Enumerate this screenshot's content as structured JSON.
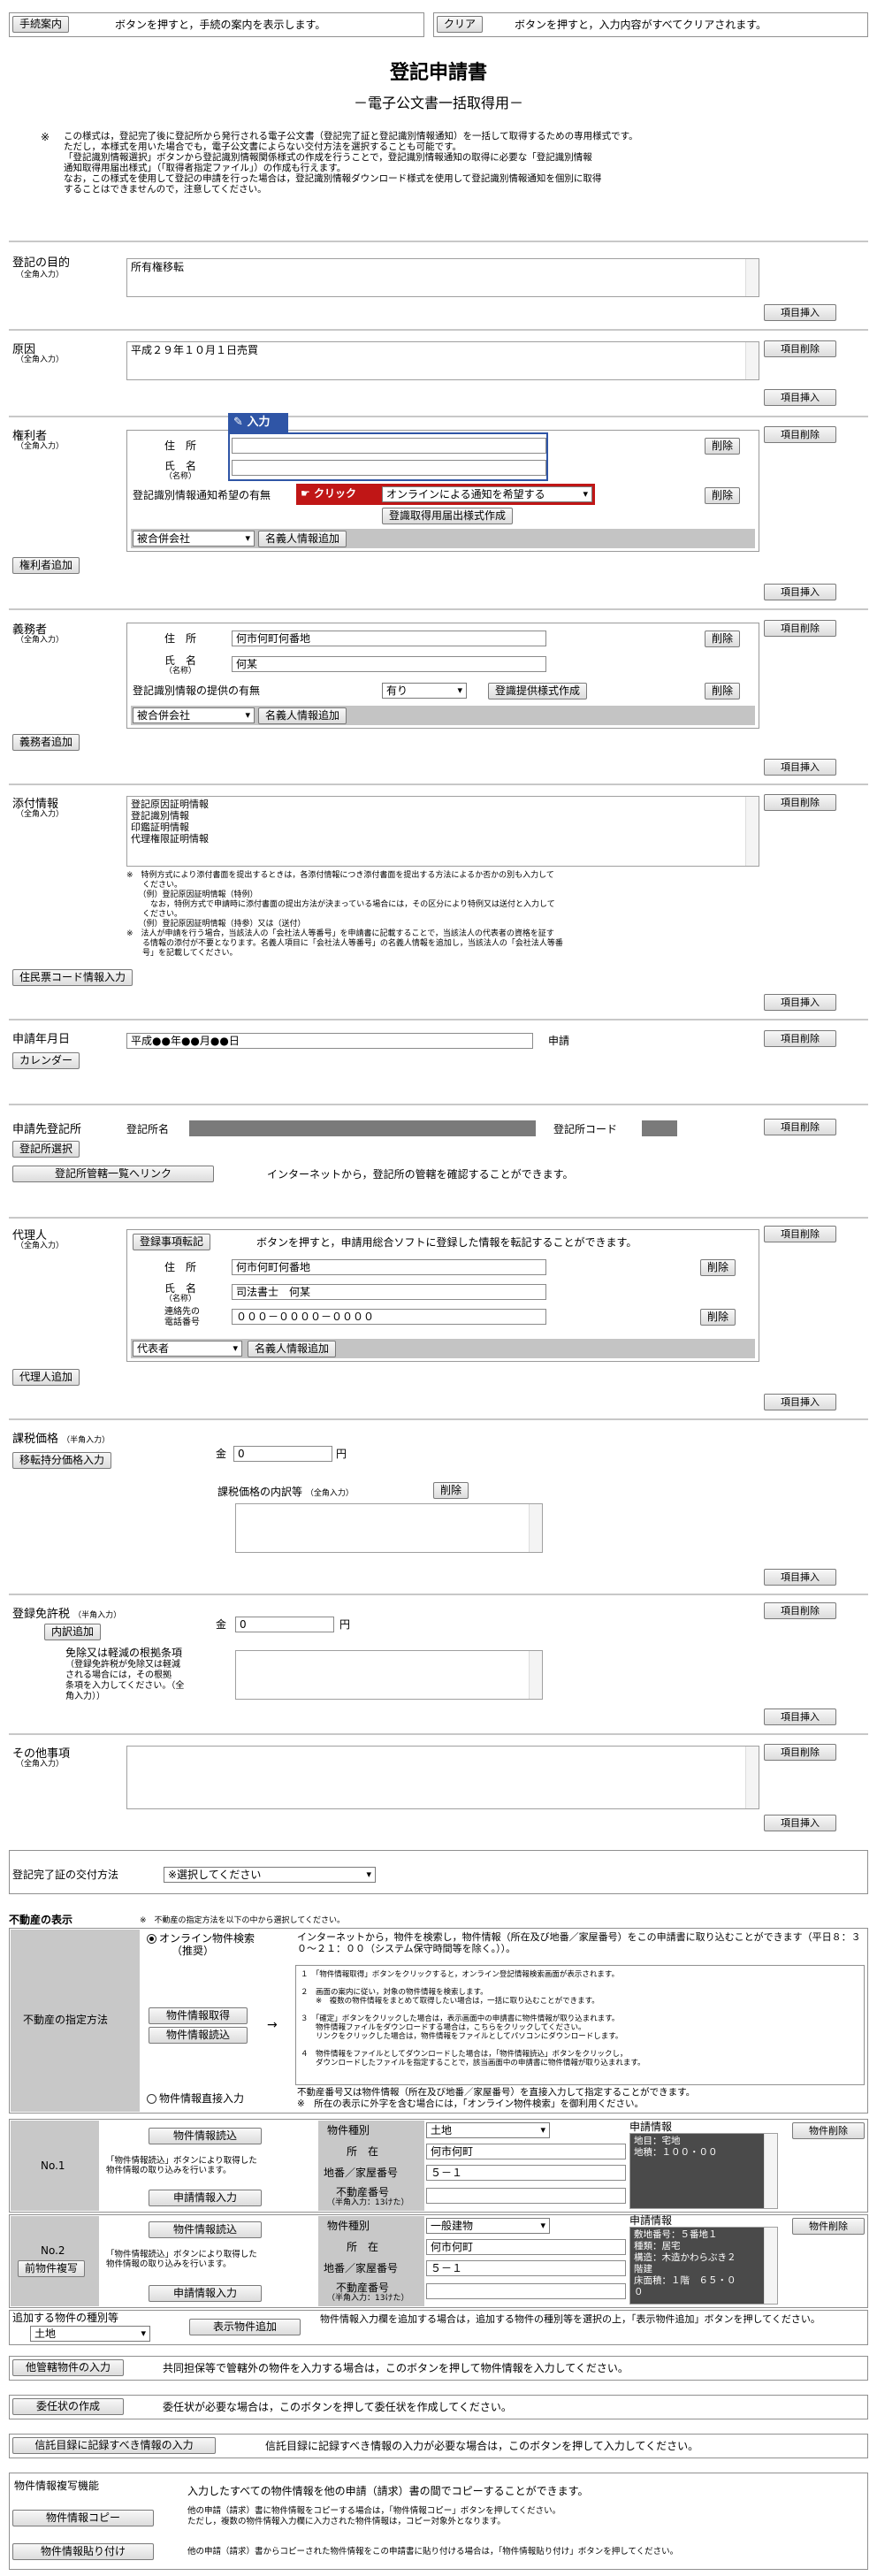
{
  "top": {
    "guide_button": "手続案内",
    "guide_text": "ボタンを押すと，手続の案内を表示します。",
    "clear_button": "クリア",
    "clear_text": "ボタンを押すと，入力内容がすべてクリアされます。"
  },
  "title": "登記申請書",
  "subtitle": "－電子公文書一括取得用－",
  "notice": {
    "mark": "※",
    "line1": "この様式は，登記完了後に登記所から発行される電子公文書（登記完了証と登記識別情報通知）を一括して取得するための専用様式です。",
    "line2": "ただし，本様式を用いた場合でも，電子公文書によらない交付方法を選択することも可能です。",
    "line3": "「登記識別情報選択」ボタンから登記識別情報関係様式の作成を行うことで，登記識別情報通知の取得に必要な「登記識別情報",
    "line4": "通知取得用届出様式」（「取得者指定ファイル」）の作成も行えます。",
    "line5": "なお，この様式を使用して登記の申請を行った場合は，登記識別情報ダウンロード様式を使用して登記識別情報通知を個別に取得",
    "line6": "することはできませんので，注意してください。"
  },
  "side": {
    "delete_item": "項目削除",
    "insert_item": "項目挿入"
  },
  "common": {
    "zen": "（全角入力）",
    "delete": "削除",
    "name_add": "名義人情報追加",
    "name_label": "氏　名",
    "name_sub": "（名称）",
    "address_label": "住　所"
  },
  "purpose": {
    "label": "登記の目的",
    "value": "所有権移転"
  },
  "cause": {
    "label": "原因",
    "value": "平成２９年１０月１日売買"
  },
  "rights": {
    "label": "権利者",
    "callout_input": "入力",
    "callout_click": "クリック",
    "notice_label": "登記識別情報通知希望の有無",
    "notice_value": "オンラインによる通知を希望する",
    "form_button": "登識取得用届出様式作成",
    "company_select": "被合併会社",
    "add_button": "権利者追加"
  },
  "duty": {
    "label": "義務者",
    "address": "何市何町何番地",
    "name": "何某",
    "provide_label": "登記識別情報の提供の有無",
    "provide_value": "有り",
    "form_button": "登識提供様式作成",
    "company_select": "被合併会社",
    "add_button": "義務者追加"
  },
  "attach": {
    "label": "添付情報",
    "value": "登記原因証明情報\n登記識別情報\n印鑑証明情報\n代理権限証明情報",
    "note": "※　特例方式により添付書面を提出するときは，各添付情報につき添付書面を提出する方法によるか否かの別も入力して\n　　ください。\n　　（例）登記原因証明情報（特例）\n　　　なお，特例方式で申請時に添付書面の提出方法が決まっている場合には，その区分により特例又は送付と入力して\n　　ください。\n　　（例）登記原因証明情報（持参）又は（送付）\n※　法人が申請を行う場合，当該法人の「会社法人等番号」を申請書に記載することで，当該法人の代表者の資格を証す\n　　る情報の添付が不要となります。名義人項目に「会社法人等番号」の名義人情報を追加し，当該法人の「会社法人等番\n　　号」を記載してください。",
    "resident_button": "住民票コード情報入力"
  },
  "date": {
    "label": "申請年月日",
    "value": "平成●●年●●月●●日",
    "suffix": "申請",
    "calendar": "カレンダー"
  },
  "office": {
    "label": "申請先登記所",
    "name_label": "登記所名",
    "code_label": "登記所コード",
    "select_button": "登記所選択",
    "link_button": "登記所管轄一覧へリンク",
    "link_text": "インターネットから，登記所の管轄を確認することができます。"
  },
  "agent": {
    "label": "代理人",
    "transfer_button": "登録事項転記",
    "transfer_text": "ボタンを押すと，申請用総合ソフトに登録した情報を転記することができます。",
    "address": "何市何町何番地",
    "name": "司法書士　何某",
    "tel_label": "連絡先の",
    "tel_label2": "電話番号",
    "tel": "０００－００００－００００",
    "role_select": "代表者",
    "add_button": "代理人追加"
  },
  "tax": {
    "label": "課税価格",
    "label_sub": "（半角入力）",
    "share_button": "移転持分価格入力",
    "amount_prefix": "金",
    "amount": "0",
    "unit": "円",
    "detail_label": "課税価格の内訳等",
    "detail_sub": "（全角入力）"
  },
  "license": {
    "label": "登録免許税",
    "label_sub": "（半角入力）",
    "detail_button": "内訳追加",
    "amount_prefix": "金",
    "amount": "0",
    "unit": "円",
    "basis_title": "免除又は軽減の根拠条項",
    "basis_text": "（登録免許税が免除又は軽減\nされる場合には，その根拠\n条項を入力してください。（全\n角入力））"
  },
  "other": {
    "label": "その他事項",
    "label_sub": "（全角入力）"
  },
  "delivery": {
    "label": "登記完了証の交付方法",
    "value": "※選択してください"
  },
  "property": {
    "heading": "不動産の表示",
    "heading_note": "※　不動産の指定方法を以下の中から選択してください。",
    "method_label": "不動産の指定方法",
    "online_radio": "オンライン物件検索",
    "online_radio_sub": "（推奨）",
    "online_text1": "インターネットから，物件を検索し，物件情報（所在及び地番／家屋番号）をこの申請書に取り込むことができます（平日８：３０～２１：００（システム保守時間等を除く。））。",
    "step_button1": "物件情報取得",
    "step_button2": "物件情報読込",
    "arrow": "→",
    "steps": "１　「物件情報取得」ボタンをクリックすると，オンライン登記情報検索画面が表示されます。\n\n２　画面の案内に従い，対象の物件情報を検索します。\n　　※　複数の物件情報をまとめて取得したい場合は，一括に取り込むことができます。\n\n３　「確定」ボタンをクリックした場合は，表示画面中の申請書に物件情報が取り込まれます。\n　　物件情報ファイルをダウンロードする場合は，こちらをクリックしてください。\n　　リンクをクリックした場合は，物件情報をファイルとしてパソコンにダウンロードします。\n\n４　物件情報をファイルとしてダウンロードした場合は，「物件情報読込」ボタンをクリックし，\n　　ダウンロードしたファイルを指定することで，該当画面中の申請書に物件情報が取り込まれます。",
    "direct_radio": "物件情報直接入力",
    "direct_text": "不動産番号又は物件情報（所在及び地番／家屋番号）を直接入力して指定することができます。\n※　所在の表示に外字を含む場合には，「オンライン物件検索」を御利用ください。",
    "items": [
      {
        "no": "No.1",
        "read_button": "物件情報読込",
        "read_note": "「物件情報読込」ボタンにより取得した\n物件情報の取り込みを行います。",
        "apply_button": "申請情報入力",
        "type_label": "物件種別",
        "type_value": "土地",
        "loc_label": "所　在",
        "loc_value": "何市何町",
        "num_label": "地番／家屋番号",
        "num_value": "５－１",
        "rn_label": "不動産番号",
        "rn_sub": "（半角入力：13けた）",
        "info_label": "申請情報",
        "info_text": "地目：宅地\n地積：１００・００",
        "delete_button": "物件削除"
      },
      {
        "no": "No.2",
        "copy_button": "前物件複写",
        "read_button": "物件情報読込",
        "read_note": "「物件情報読込」ボタンにより取得した\n物件情報の取り込みを行います。",
        "apply_button": "申請情報入力",
        "type_label": "物件種別",
        "type_value": "一般建物",
        "loc_label": "所　在",
        "loc_value": "何市何町",
        "num_label": "地番／家屋番号",
        "num_value": "５－１",
        "rn_label": "不動産番号",
        "rn_sub": "（半角入力：13けた）",
        "info_label": "申請情報",
        "info_text": "敷地番号：５番地１\n種類：居宅\n構造：木造かわらぶき２\n階建\n床面積：１階　６５・０\n０",
        "delete_button": "物件削除"
      }
    ],
    "add_type_label": "追加する物件の種別等",
    "add_type_value": "土地",
    "add_button": "表示物件追加",
    "add_text": "物件情報入力欄を追加する場合は，追加する物件の種別等を選択の上，「表示物件追加」ボタンを押してください。"
  },
  "footer": {
    "other_button": "他管轄物件の入力",
    "other_text": "共同担保等で管轄外の物件を入力する場合は，このボタンを押して物件情報を入力してください。",
    "proxy_button": "委任状の作成",
    "proxy_text": "委任状が必要な場合は，このボタンを押して委任状を作成してください。",
    "trust_button": "信託目録に記録すべき情報の入力",
    "trust_text": "信託目録に記録すべき情報の入力が必要な場合は，このボタンを押して入力してください。",
    "copy_title": "物件情報複写機能",
    "copy_desc": "入力したすべての物件情報を他の申請（請求）書の間でコピーすることができます。",
    "copy_button": "物件情報コピー",
    "copy_text": "他の申請（請求）書に物件情報をコピーする場合は，「物件情報コピー」ボタンを押してください。\nただし，複数の物件情報入力欄に入力された物件情報は，コピー対象外となります。",
    "paste_button": "物件情報貼り付け",
    "paste_text": "他の申請（請求）書からコピーされた物件情報をこの申請書に貼り付ける場合は，「物件情報貼り付け」ボタンを押してください。"
  }
}
